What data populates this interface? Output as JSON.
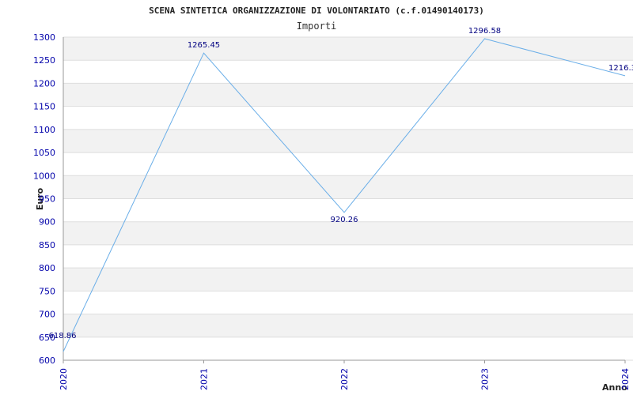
{
  "chart_data": {
    "type": "line",
    "title": "SCENA SINTETICA ORGANIZZAZIONE DI VOLONTARIATO (c.f.01490140173)",
    "subtitle": "Importi",
    "xlabel": "Anno",
    "ylabel": "Euro",
    "categories": [
      "2020",
      "2021",
      "2022",
      "2023",
      "2024"
    ],
    "series": [
      {
        "values": [
          618.86,
          1265.45,
          920.26,
          1296.58,
          1216.3
        ],
        "labels": [
          "618.86",
          "1265.45",
          "920.26",
          "1296.58",
          "1216.3"
        ]
      }
    ],
    "ylim": [
      600,
      1300
    ],
    "yticks": [
      "600",
      "650",
      "700",
      "750",
      "800",
      "850",
      "900",
      "950",
      "1000",
      "1050",
      "1100",
      "1150",
      "1200",
      "1250",
      "1300"
    ],
    "grid": true,
    "line_color": "#6aaee8",
    "tick_color": "#0000aa",
    "band_color": "#f2f2f2"
  }
}
